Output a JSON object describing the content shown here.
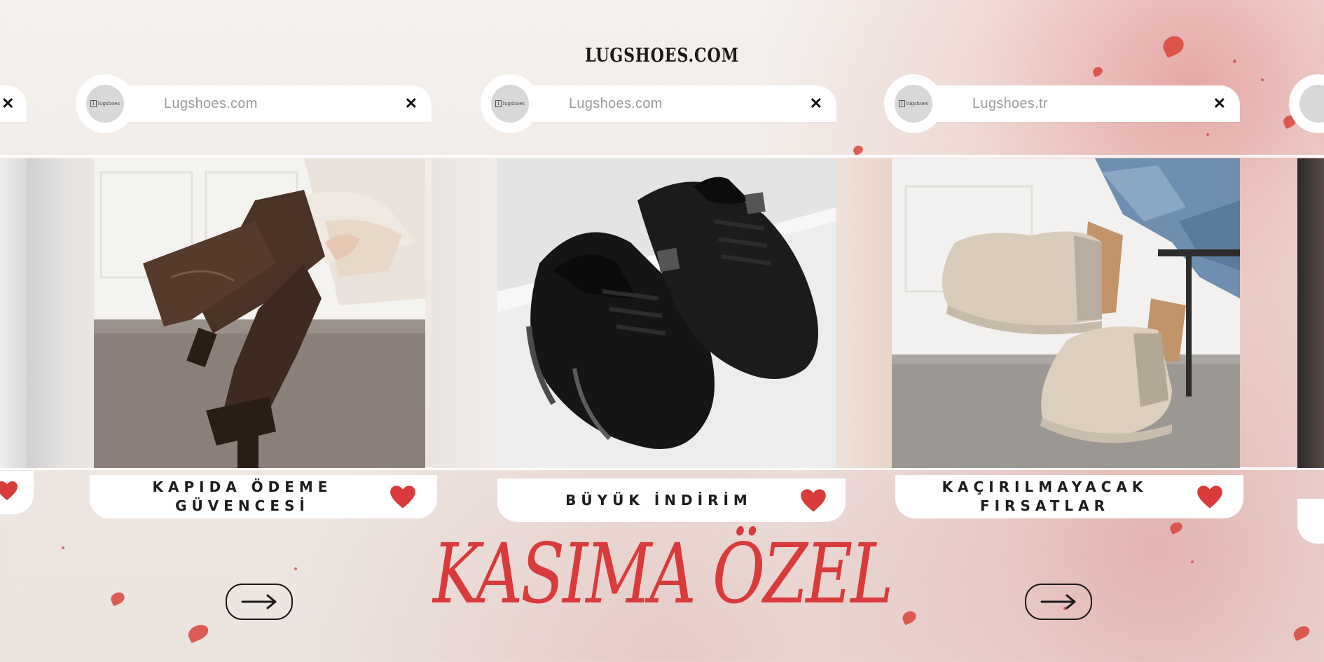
{
  "brand": {
    "title": "LUGSHOES.COM"
  },
  "cards": [
    {
      "url": "Lugshoes.com",
      "label": "KAPIDA ÖDEME GÜVENCESİ",
      "image": "brown knee-high leather boots"
    },
    {
      "url": "Lugshoes.com",
      "label": "BÜYÜK İNDİRİM",
      "image": "black knit sneakers"
    },
    {
      "url": "Lugshoes.tr",
      "label": "KAÇIRILMAYACAK FIRSATLAR",
      "image": "beige chelsea boots"
    }
  ],
  "logo_text": "lugshoes",
  "headline": "KASIMA ÖZEL",
  "icons": {
    "close": "close-icon",
    "heart": "heart-icon",
    "arrow": "arrow-right-icon"
  },
  "colors": {
    "accent": "#d93a3a",
    "text": "#1c1c1c",
    "url_gray": "#9b9b9b"
  }
}
